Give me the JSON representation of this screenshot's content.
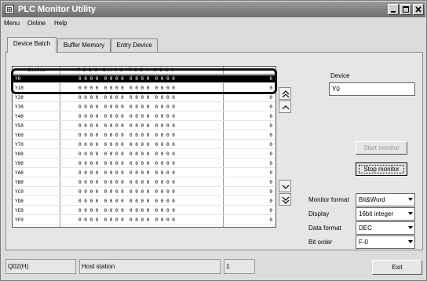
{
  "window": {
    "title": "PLC Monitor Utility"
  },
  "menu": {
    "items": [
      "Menu",
      "Online",
      "Help"
    ]
  },
  "tabs": [
    "Device Batch",
    "Buffer Memory",
    "Entry Device"
  ],
  "grid": {
    "header_device": "Device",
    "header_bits": "+F E D C +B A 9 8 +7 6 5 4 +3 2 1 0",
    "rows": [
      {
        "device": "Y0",
        "bits": "0 0 0 0  0 0 0 0  0 0 0 0  0 0 0 0",
        "value": "0"
      },
      {
        "device": "Y10",
        "bits": "0 0 0 0  0 0 0 0  0 0 0 0  0 0 0 0",
        "value": "0"
      },
      {
        "device": "Y20",
        "bits": "0 0 0 0  0 0 0 0  0 0 0 0  0 0 0 0",
        "value": "0"
      },
      {
        "device": "Y30",
        "bits": "0 0 0 0  0 0 0 0  0 0 0 0  0 0 0 0",
        "value": "0"
      },
      {
        "device": "Y40",
        "bits": "0 0 0 0  0 0 0 0  0 0 0 0  0 0 0 0",
        "value": "0"
      },
      {
        "device": "Y50",
        "bits": "0 0 0 0  0 0 0 0  0 0 0 0  0 0 0 0",
        "value": "0"
      },
      {
        "device": "Y60",
        "bits": "0 0 0 0  0 0 0 0  0 0 0 0  0 0 0 0",
        "value": "0"
      },
      {
        "device": "Y70",
        "bits": "0 0 0 0  0 0 0 0  0 0 0 0  0 0 0 0",
        "value": "0"
      },
      {
        "device": "Y80",
        "bits": "0 0 0 0  0 0 0 0  0 0 0 0  0 0 0 0",
        "value": "0"
      },
      {
        "device": "Y90",
        "bits": "0 0 0 0  0 0 0 0  0 0 0 0  0 0 0 0",
        "value": "0"
      },
      {
        "device": "YA0",
        "bits": "0 0 0 0  0 0 0 0  0 0 0 0  0 0 0 0",
        "value": "0"
      },
      {
        "device": "YB0",
        "bits": "0 0 0 0  0 0 0 0  0 0 0 0  0 0 0 0",
        "value": "0"
      },
      {
        "device": "YC0",
        "bits": "0 0 0 0  0 0 0 0  0 0 0 0  0 0 0 0",
        "value": "0"
      },
      {
        "device": "YD0",
        "bits": "0 0 0 0  0 0 0 0  0 0 0 0  0 0 0 0",
        "value": "0"
      },
      {
        "device": "YE0",
        "bits": "0 0 0 0  0 0 0 0  0 0 0 0  0 0 0 0",
        "value": "0"
      },
      {
        "device": "YF0",
        "bits": "0 0 0 0  0 0 0 0  0 0 0 0  0 0 0 0",
        "value": "0"
      }
    ]
  },
  "right_panel": {
    "device_label": "Device",
    "device_value": "Y0",
    "start_monitor": "Start monitor",
    "stop_monitor": "Stop monitor",
    "monitor_format_label": "Monitor format",
    "monitor_format_value": "Bit&Word",
    "display_label": "Display",
    "display_value": "16bit integer",
    "data_format_label": "Data format",
    "data_format_value": "DEC",
    "bit_order_label": "Bit order",
    "bit_order_value": "F-0"
  },
  "status": {
    "cpu": "Q02(H)",
    "connection": "Host station",
    "station_no": "1",
    "exit_label": "Exit"
  },
  "icons": {
    "scroll_top": "double-chevron-up-icon",
    "scroll_up": "chevron-up-icon",
    "scroll_down": "chevron-down-icon",
    "scroll_bottom": "double-chevron-down-icon"
  }
}
